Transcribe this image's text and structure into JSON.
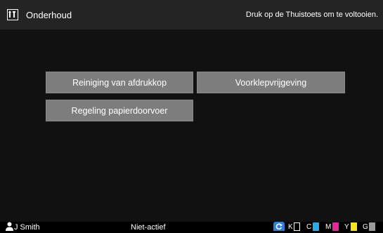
{
  "header": {
    "title": "Onderhoud",
    "hint": "Druk op de Thuistoets om te voltooien."
  },
  "buttons": {
    "head_cleaning": "Reiniging van afdrukkop",
    "front_cover_release": "Voorklepvrijgeving",
    "paper_feed_adjust": "Regeling papierdoorvoer"
  },
  "status": {
    "user": "J Smith",
    "state": "Niet-actief",
    "inks": [
      {
        "label": "K",
        "color": "#ffffff",
        "level": 0
      },
      {
        "label": "C",
        "color": "#29aee3",
        "level": 1
      },
      {
        "label": "M",
        "color": "#e3279a",
        "level": 1
      },
      {
        "label": "Y",
        "color": "#f5e51c",
        "level": 1
      },
      {
        "label": "G",
        "color": "#9a9a9a",
        "level": 1
      }
    ]
  },
  "colors": {
    "title_bar": "#242424",
    "button": "#7d7d7d",
    "refresh": "#2f7fd7"
  }
}
